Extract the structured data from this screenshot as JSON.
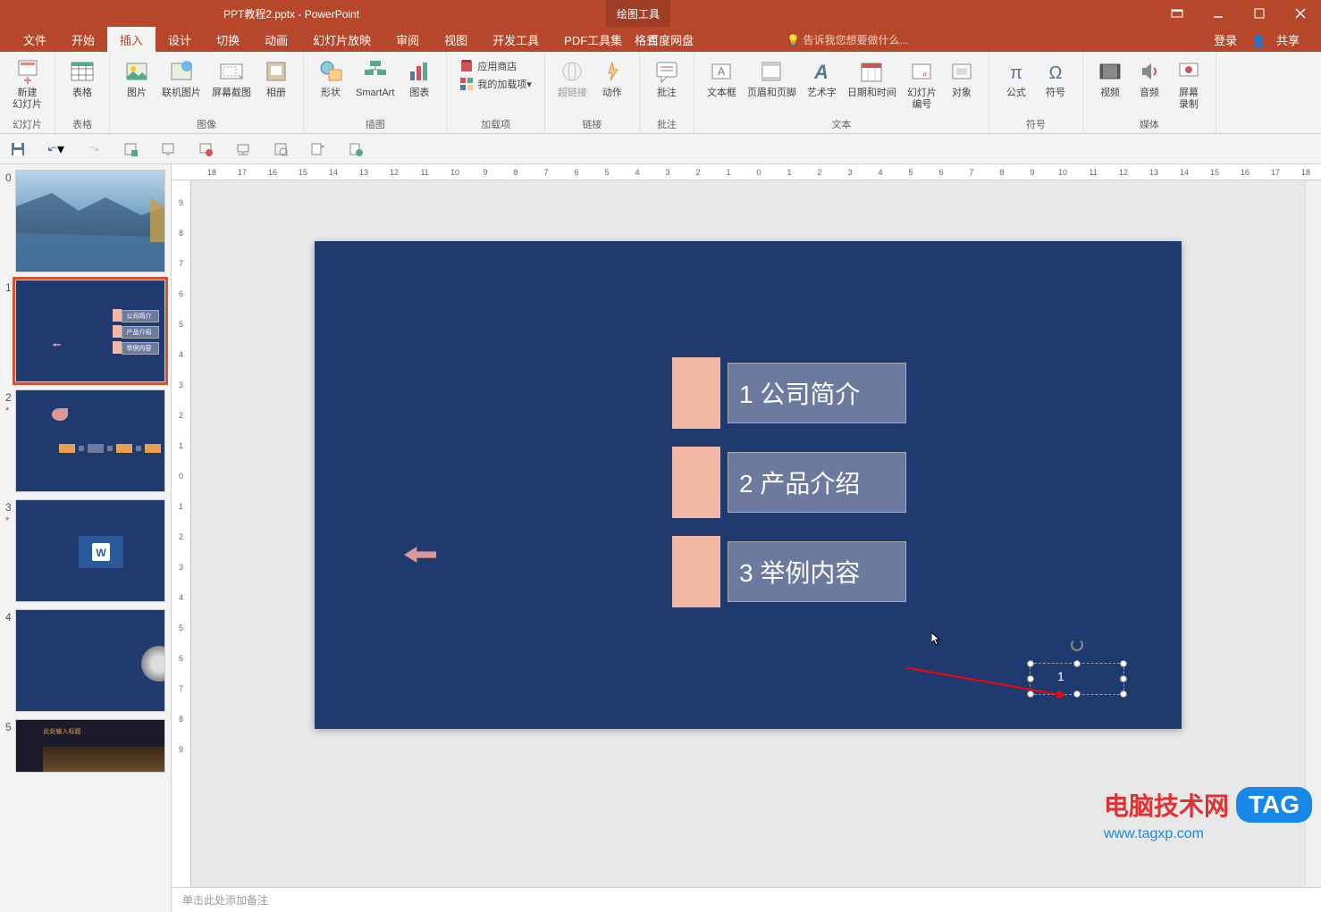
{
  "title": {
    "filename": "PPT教程2.pptx - PowerPoint",
    "contextTab": "绘图工具",
    "contextSub": "格式"
  },
  "menu": {
    "file": "文件",
    "home": "开始",
    "insert": "插入",
    "design": "设计",
    "transition": "切换",
    "animation": "动画",
    "slideshow": "幻灯片放映",
    "review": "审阅",
    "view": "视图",
    "developer": "开发工具",
    "pdf": "PDF工具集",
    "baidu": "百度网盘",
    "tellme": "告诉我您想要做什么...",
    "login": "登录",
    "share": "共享"
  },
  "ribbon": {
    "slides": {
      "label": "幻灯片",
      "newSlide": "新建\n幻灯片"
    },
    "tables": {
      "label": "表格",
      "table": "表格"
    },
    "images": {
      "label": "图像",
      "picture": "图片",
      "online": "联机图片",
      "screenshot": "屏幕截图",
      "album": "相册"
    },
    "illus": {
      "label": "插图",
      "shapes": "形状",
      "smartart": "SmartArt",
      "chart": "图表"
    },
    "addins": {
      "label": "加载项",
      "store": "应用商店",
      "myaddins": "我的加载项"
    },
    "links": {
      "label": "链接",
      "hyperlink": "超链接",
      "action": "动作"
    },
    "comments": {
      "label": "批注",
      "comment": "批注"
    },
    "text": {
      "label": "文本",
      "textbox": "文本框",
      "headerfooter": "页眉和页脚",
      "wordart": "艺术字",
      "datetime": "日期和时间",
      "slidenum": "幻灯片\n编号",
      "object": "对象"
    },
    "symbols": {
      "label": "符号",
      "equation": "公式",
      "symbol": "符号"
    },
    "media": {
      "label": "媒体",
      "video": "视频",
      "audio": "音频",
      "screenrec": "屏幕\n录制"
    }
  },
  "slides": [
    {
      "num": "0"
    },
    {
      "num": "1",
      "star": "",
      "items": [
        "公司简介",
        "产品介绍",
        "举例内容"
      ]
    },
    {
      "num": "2",
      "star": "*"
    },
    {
      "num": "3",
      "star": "*"
    },
    {
      "num": "4"
    },
    {
      "num": "5"
    }
  ],
  "canvas": {
    "item1": "1 公司简介",
    "item2": "2 产品介绍",
    "item3": "3 举例内容",
    "selText": "1"
  },
  "rulerH": [
    "18",
    "17",
    "16",
    "15",
    "14",
    "13",
    "12",
    "11",
    "10",
    "9",
    "8",
    "7",
    "6",
    "5",
    "4",
    "3",
    "2",
    "1",
    "0",
    "1",
    "2",
    "3",
    "4",
    "5",
    "6",
    "7",
    "8",
    "9",
    "10",
    "11",
    "12",
    "13",
    "14",
    "15",
    "16",
    "17",
    "18"
  ],
  "rulerV": [
    "9",
    "8",
    "7",
    "6",
    "5",
    "4",
    "3",
    "2",
    "1",
    "0",
    "1",
    "2",
    "3",
    "4",
    "5",
    "6",
    "7",
    "8",
    "9"
  ],
  "notes": "单击此处添加备注",
  "watermark": {
    "text": "电脑技术网",
    "tag": "TAG",
    "url": "www.tagxp.com"
  }
}
